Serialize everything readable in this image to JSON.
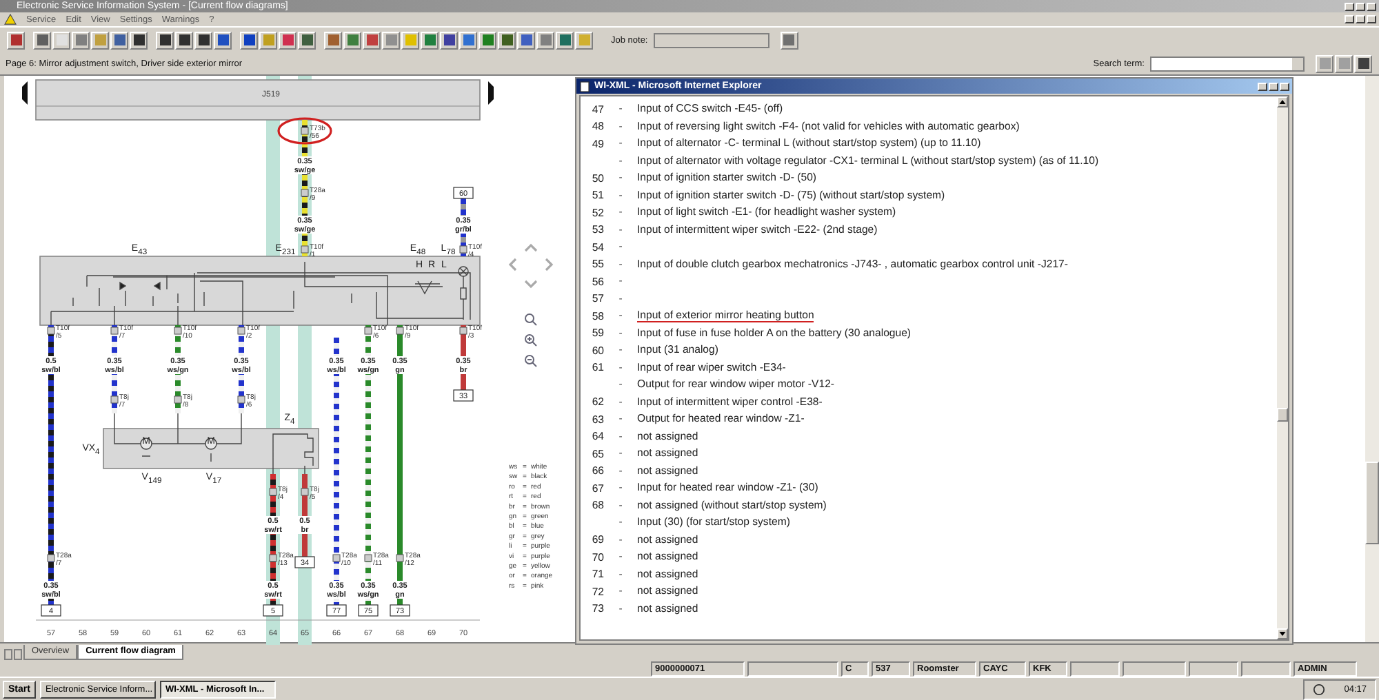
{
  "window": {
    "title": "Electronic Service Information System - [Current flow diagrams]"
  },
  "menu": [
    {
      "label": "Service"
    },
    {
      "label": "Edit"
    },
    {
      "label": "View"
    },
    {
      "label": "Settings"
    },
    {
      "label": "Warnings"
    },
    {
      "label": "?"
    }
  ],
  "toolbar": {
    "job_note_label": "Job note:"
  },
  "info_bar": {
    "page_title": "Page 6: Mirror adjustment switch, Driver side exterior mirror",
    "search_label": "Search term:"
  },
  "diagram": {
    "control_unit": "J519",
    "components": [
      {
        "label": "E$_{43}$"
      },
      {
        "label": "E$_{231}$"
      },
      {
        "label": "E$_{48}$"
      },
      {
        "label": "L$_{78}$"
      },
      {
        "label": "H"
      },
      {
        "label": "R"
      },
      {
        "label": "L"
      },
      {
        "label": "Z$_{4}$"
      },
      {
        "label": "VX$_{4}$"
      },
      {
        "label": "V$_{149}$"
      },
      {
        "label": "V$_{17}$"
      },
      {
        "label": "M"
      },
      {
        "label": "M"
      }
    ],
    "wires": [
      {
        "color": "#1a1a1a",
        "stripe": {
          "color": "#2233cc"
        },
        "circled": false,
        "labels": [
          {
            "kind": "connector",
            "name": "T10f",
            "pin": "/5"
          },
          {
            "kind": "gauge",
            "size": "0.5",
            "code": "sw/bl"
          },
          {
            "kind": "connector",
            "name": "T28a",
            "pin": "/7"
          },
          {
            "kind": "gauge",
            "size": "0.35",
            "code": "sw/bl"
          },
          {
            "kind": "terminal",
            "number": "4"
          }
        ]
      },
      {
        "color": "#f0f0f0",
        "stripe": {
          "color": "#2233cc"
        },
        "circled": false,
        "labels": [
          {
            "kind": "connector",
            "name": "T10f",
            "pin": "/7"
          },
          {
            "kind": "gauge",
            "size": "0.35",
            "code": "ws/bl"
          },
          {
            "kind": "connector",
            "name": "T8j",
            "pin": "/7"
          }
        ]
      },
      {
        "color": "#f0f0f0",
        "stripe": {
          "color": "#2a8a2a"
        },
        "circled": false,
        "labels": [
          {
            "kind": "connector",
            "name": "T10f",
            "pin": "/10"
          },
          {
            "kind": "gauge",
            "size": "0.35",
            "code": "ws/gn"
          },
          {
            "kind": "connector",
            "name": "T8j",
            "pin": "/8"
          }
        ]
      },
      {
        "color": "#f0f0f0",
        "stripe": {
          "color": "#2233cc"
        },
        "circled": false,
        "labels": [
          {
            "kind": "connector",
            "name": "T10f",
            "pin": "/2"
          },
          {
            "kind": "gauge",
            "size": "0.35",
            "code": "ws/bl"
          },
          {
            "kind": "connector",
            "name": "T8j",
            "pin": "/6"
          }
        ]
      },
      {
        "color": "#1a1a1a",
        "stripe": {
          "color": "#d03030"
        },
        "circled": false,
        "labels": [
          {
            "kind": "connector",
            "name": "T8j",
            "pin": "/4"
          },
          {
            "kind": "gauge",
            "size": "0.5",
            "code": "sw/rt"
          },
          {
            "kind": "connector",
            "name": "T28a",
            "pin": "/13"
          },
          {
            "kind": "gauge",
            "size": "0.5",
            "code": "sw/rt"
          },
          {
            "kind": "terminal",
            "number": "5"
          }
        ]
      },
      {
        "color": "#c03a3a",
        "circled": false,
        "labels": [
          {
            "kind": "connector",
            "name": "T8j",
            "pin": "/5"
          },
          {
            "kind": "gauge",
            "size": "0.5",
            "code": "br"
          },
          {
            "kind": "terminal",
            "number": "34"
          }
        ]
      },
      {
        "color": "#f0f0f0",
        "stripe": {
          "color": "#2233cc"
        },
        "circled": false,
        "labels": [
          {
            "kind": "gauge",
            "size": "0.35",
            "code": "ws/bl"
          },
          {
            "kind": "connector",
            "name": "T28a",
            "pin": "/10"
          },
          {
            "kind": "gauge",
            "size": "0.35",
            "code": "ws/bl"
          },
          {
            "kind": "terminal",
            "number": "77"
          }
        ]
      },
      {
        "color": "#f0f0f0",
        "stripe": {
          "color": "#2a8a2a"
        },
        "circled": false,
        "labels": [
          {
            "kind": "connector",
            "name": "T10f",
            "pin": "/6"
          },
          {
            "kind": "gauge",
            "size": "0.35",
            "code": "ws/gn"
          },
          {
            "kind": "connector",
            "name": "T28a",
            "pin": "/11"
          },
          {
            "kind": "gauge",
            "size": "0.35",
            "code": "ws/gn"
          },
          {
            "kind": "terminal",
            "number": "75"
          }
        ]
      },
      {
        "color": "#2a8a2a",
        "circled": false,
        "labels": [
          {
            "kind": "connector",
            "name": "T10f",
            "pin": "/9"
          },
          {
            "kind": "gauge",
            "size": "0.35",
            "code": "gn"
          },
          {
            "kind": "connector",
            "name": "T28a",
            "pin": "/12"
          },
          {
            "kind": "gauge",
            "size": "0.35",
            "code": "gn"
          },
          {
            "kind": "terminal",
            "number": "73"
          }
        ]
      },
      {
        "color": "#c03a3a",
        "circled": false,
        "labels": [
          {
            "kind": "connector",
            "name": "T10f",
            "pin": "/3"
          },
          {
            "kind": "gauge",
            "size": "0.35",
            "code": "br"
          },
          {
            "kind": "terminal",
            "number": "33"
          }
        ]
      },
      {
        "color": "#1a1a1a",
        "stripe": {
          "color": "#e8e030"
        },
        "circled": true,
        "labels": [
          {
            "kind": "connector",
            "name": "T73b",
            "pin": "/56"
          },
          {
            "kind": "gauge",
            "size": "0.35",
            "code": "sw/ge"
          },
          {
            "kind": "connector",
            "name": "T28a",
            "pin": "/9"
          },
          {
            "kind": "gauge",
            "size": "0.35",
            "code": "sw/ge"
          },
          {
            "kind": "connector",
            "name": "T10f",
            "pin": "/1"
          }
        ]
      },
      {
        "color": "#2233cc",
        "stripe": {
          "color": "#999999"
        },
        "circled": false,
        "labels": [
          {
            "kind": "terminal",
            "number": "60"
          },
          {
            "kind": "gauge",
            "size": "0.35",
            "code": "gr/bl"
          },
          {
            "kind": "connector",
            "name": "T10f",
            "pin": "/4"
          }
        ]
      }
    ],
    "columns": [
      {
        "number": "57",
        "highlighted": false
      },
      {
        "number": "58",
        "highlighted": false
      },
      {
        "number": "59",
        "highlighted": false
      },
      {
        "number": "60",
        "highlighted": false
      },
      {
        "number": "61",
        "highlighted": false
      },
      {
        "number": "62",
        "highlighted": false
      },
      {
        "number": "63",
        "highlighted": false
      },
      {
        "number": "64",
        "highlighted": true
      },
      {
        "number": "65",
        "highlighted": true
      },
      {
        "number": "66",
        "highlighted": false
      },
      {
        "number": "67",
        "highlighted": false
      },
      {
        "number": "68",
        "highlighted": false
      },
      {
        "number": "69",
        "highlighted": false
      },
      {
        "number": "70",
        "highlighted": false
      }
    ],
    "legend": [
      {
        "code": "ws",
        "meaning": "white"
      },
      {
        "code": "sw",
        "meaning": "black"
      },
      {
        "code": "ro",
        "meaning": "red"
      },
      {
        "code": "rt",
        "meaning": "red"
      },
      {
        "code": "br",
        "meaning": "brown"
      },
      {
        "code": "gn",
        "meaning": "green"
      },
      {
        "code": "bl",
        "meaning": "blue"
      },
      {
        "code": "gr",
        "meaning": "grey"
      },
      {
        "code": "li",
        "meaning": "purple"
      },
      {
        "code": "vi",
        "meaning": "purple"
      },
      {
        "code": "ge",
        "meaning": "yellow"
      },
      {
        "code": "or",
        "meaning": "orange"
      },
      {
        "code": "rs",
        "meaning": "pink"
      }
    ],
    "legend_separator": "="
  },
  "browser_window": {
    "title": "WI-XML - Microsoft Internet Explorer",
    "rows": [
      {
        "number": "47",
        "separator": "-",
        "text": "Input of CCS switch -E45- (off)",
        "underlined": false
      },
      {
        "number": "48",
        "separator": "-",
        "text": "Input of reversing light switch -F4- (not valid for vehicles with automatic gearbox)",
        "underlined": false
      },
      {
        "number": "49",
        "separator": "-",
        "text": "Input of alternator -C- terminal L (without start/stop system) (up to 11.10)",
        "underlined": false
      },
      {
        "separator": "-",
        "text": "Input of alternator with voltage regulator -CX1- terminal L (without start/stop system) (as of 11.10)",
        "underlined": false
      },
      {
        "number": "50",
        "separator": "-",
        "text": "Input of ignition starter switch -D- (50)",
        "underlined": false
      },
      {
        "number": "51",
        "separator": "-",
        "text": "Input of ignition starter switch -D- (75) (without start/stop system)",
        "underlined": false
      },
      {
        "number": "52",
        "separator": "-",
        "text": "Input of light switch -E1- (for headlight washer system)",
        "underlined": false
      },
      {
        "number": "53",
        "separator": "-",
        "text": "Input of intermittent wiper switch -E22- (2nd stage)",
        "underlined": false
      },
      {
        "number": "54",
        "separator": "-",
        "underlined": false
      },
      {
        "number": "55",
        "separator": "-",
        "text": "Input of double clutch gearbox mechatronics -J743- , automatic gearbox control unit -J217-",
        "underlined": false
      },
      {
        "number": "56",
        "separator": "-",
        "underlined": false
      },
      {
        "number": "57",
        "separator": "-",
        "underlined": false
      },
      {
        "number": "58",
        "separator": "-",
        "text": "Input of exterior mirror heating button",
        "underlined": true
      },
      {
        "number": "59",
        "separator": "-",
        "text": "Input of fuse in fuse holder A on the battery (30 analogue)",
        "underlined": false
      },
      {
        "number": "60",
        "separator": "-",
        "text": "Input (31 analog)",
        "underlined": false
      },
      {
        "number": "61",
        "separator": "-",
        "text": "Input of rear wiper switch -E34-",
        "underlined": false
      },
      {
        "separator": "-",
        "text": "Output for rear window wiper motor -V12-",
        "underlined": false
      },
      {
        "number": "62",
        "separator": "-",
        "text": "Input of intermittent wiper control -E38-",
        "underlined": false
      },
      {
        "number": "63",
        "separator": "-",
        "text": "Output for heated rear window -Z1-",
        "underlined": false
      },
      {
        "number": "64",
        "separator": "-",
        "text": "not assigned",
        "underlined": false
      },
      {
        "number": "65",
        "separator": "-",
        "text": "not assigned",
        "underlined": false
      },
      {
        "number": "66",
        "separator": "-",
        "text": "not assigned",
        "underlined": false
      },
      {
        "number": "67",
        "separator": "-",
        "text": "Input for heated rear window -Z1- (30)",
        "underlined": false
      },
      {
        "number": "68",
        "separator": "-",
        "text": "not assigned (without start/stop system)",
        "underlined": false
      },
      {
        "separator": "-",
        "text": "Input (30) (for start/stop system)",
        "underlined": false
      },
      {
        "number": "69",
        "separator": "-",
        "text": "not assigned",
        "underlined": false
      },
      {
        "number": "70",
        "separator": "-",
        "text": "not assigned",
        "underlined": false
      },
      {
        "number": "71",
        "separator": "-",
        "text": "not assigned",
        "underlined": false
      },
      {
        "number": "72",
        "separator": "-",
        "text": "not assigned",
        "underlined": false
      },
      {
        "number": "73",
        "separator": "-",
        "text": "not assigned",
        "underlined": false
      }
    ]
  },
  "tabs": [
    {
      "label": "Overview",
      "selected": false
    },
    {
      "label": "Current flow diagram",
      "selected": true
    }
  ],
  "status_bar": [
    {
      "text": "9000000071"
    },
    {
      "text": "C"
    },
    {
      "text": "537"
    },
    {
      "text": "Roomster"
    },
    {
      "text": "CAYC"
    },
    {
      "text": "KFK"
    },
    {
      "text": "ADMIN"
    }
  ],
  "taskbar": {
    "start": "Start",
    "tasks": [
      {
        "label": "Electronic Service Inform...",
        "selected": false
      },
      {
        "label": "WI-XML - Microsoft In...",
        "selected": true
      }
    ],
    "clock": "04:17"
  }
}
